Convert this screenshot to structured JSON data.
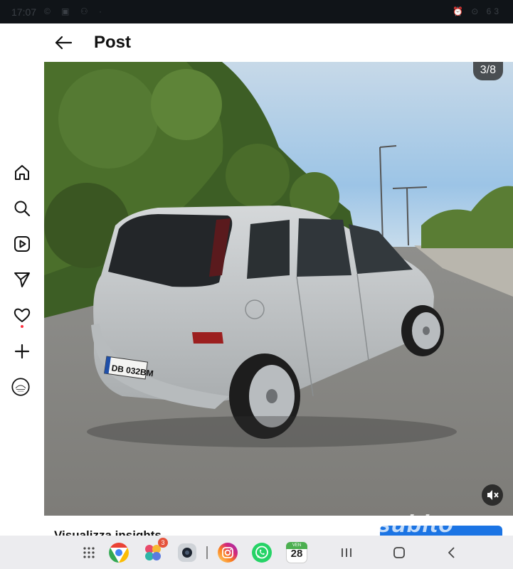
{
  "status_bar": {
    "time": "17:07",
    "left_icons": "© ▣ ⚇ ·",
    "right_icons": "⏰ ⊙ 63"
  },
  "header": {
    "title": "Post"
  },
  "photo": {
    "counter": "3/8",
    "plate": "DB 032BM"
  },
  "caption": {
    "text": "Visualizza insights"
  },
  "watermark": "subito",
  "sidebar": {
    "items": [
      "home-icon",
      "search-icon",
      "reels-icon",
      "send-icon",
      "heart-icon",
      "create-icon",
      "profile-avatar"
    ]
  },
  "navbar": {
    "apps": [
      "app-drawer",
      "chrome",
      "gallery",
      "camera",
      "instagram",
      "whatsapp",
      "calendar"
    ],
    "gallery_badge": "3",
    "calendar_label": "VEN",
    "calendar_day": "28"
  },
  "colors": {
    "accent_blue": "#1b74e4",
    "notification_red": "#ff3040"
  }
}
